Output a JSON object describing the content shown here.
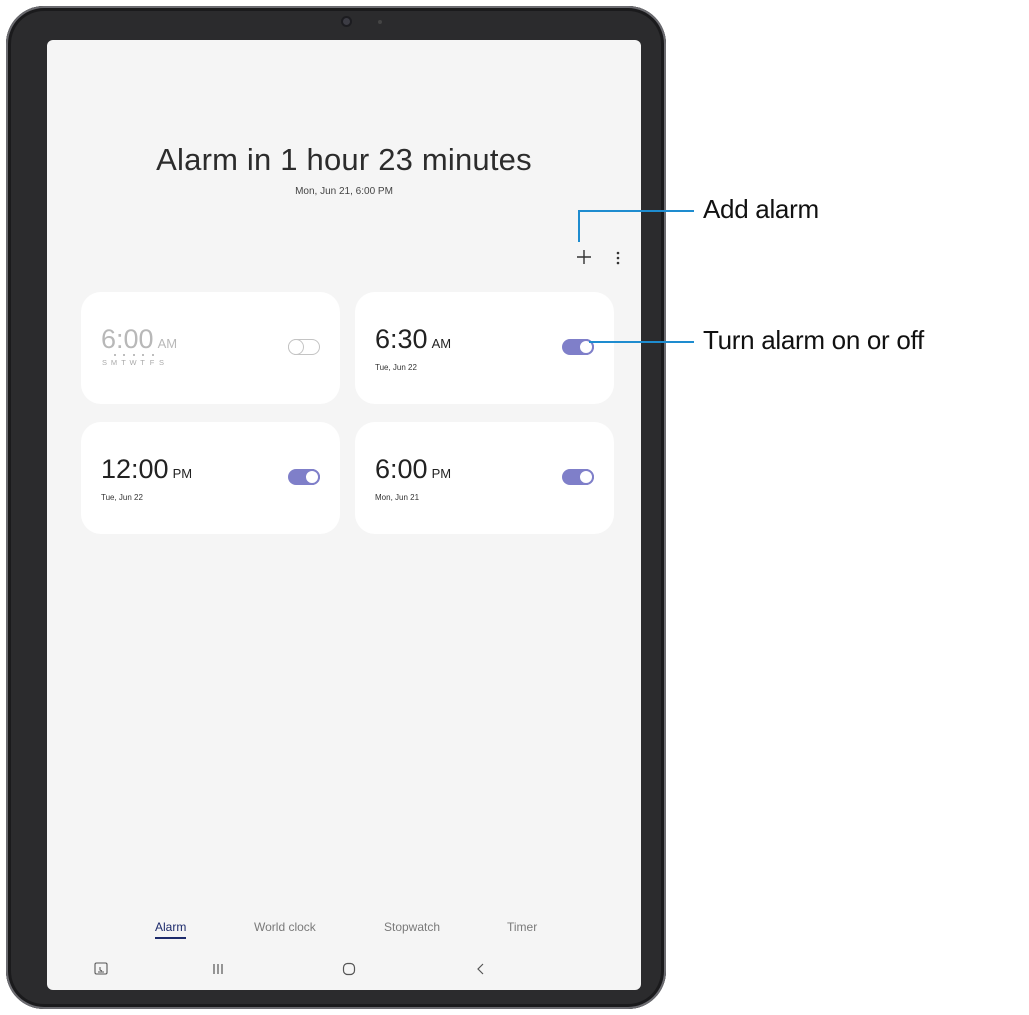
{
  "alarm_screen": {
    "title": "Alarm in 1 hour 23 minutes",
    "subtitle": "Mon, Jun 21, 6:00 PM",
    "toolbar": {
      "add_icon": "plus-icon",
      "more_icon": "more-vertical-icon"
    },
    "alarms": [
      {
        "time": "6:00",
        "ampm": "AM",
        "days": [
          "S",
          "M",
          "T",
          "W",
          "T",
          "F",
          "S"
        ],
        "selected_days": [
          false,
          true,
          true,
          true,
          true,
          true,
          false
        ],
        "enabled": false
      },
      {
        "time": "6:30",
        "ampm": "AM",
        "date": "Tue, Jun 22",
        "enabled": true
      },
      {
        "time": "12:00",
        "ampm": "PM",
        "date": "Tue, Jun 22",
        "enabled": true
      },
      {
        "time": "6:00",
        "ampm": "PM",
        "date": "Mon, Jun 21",
        "enabled": true
      }
    ],
    "tabs": [
      {
        "label": "Alarm",
        "active": true
      },
      {
        "label": "World clock",
        "active": false
      },
      {
        "label": "Stopwatch",
        "active": false
      },
      {
        "label": "Timer",
        "active": false
      }
    ],
    "navbar": [
      "screenshot-icon",
      "recent-apps-icon",
      "home-icon",
      "back-icon"
    ]
  },
  "annotations": {
    "add_alarm": "Add alarm",
    "toggle": "Turn alarm on or off"
  },
  "colors": {
    "accent": "#7f7fc9",
    "callout": "#1e8ccf",
    "tab_active": "#1c2a6b"
  }
}
